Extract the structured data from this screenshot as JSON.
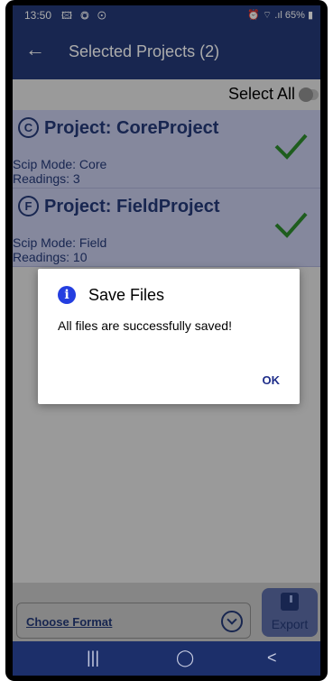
{
  "status_bar": {
    "time": "13:50",
    "icons_left": "🖾 ◎ ⊙",
    "right": "⏰ ⌔ .ıl 65% ▮"
  },
  "app_bar": {
    "title": "Selected Projects (2)"
  },
  "select_all": {
    "label": "Select All",
    "checked": false
  },
  "projects": [
    {
      "icon": "C",
      "title": "Project: CoreProject",
      "mode": "Scip Mode: Core",
      "readings": "Readings: 3",
      "selected": true
    },
    {
      "icon": "F",
      "title": "Project: FieldProject",
      "mode": "Scip Mode: Field",
      "readings": "Readings: 10",
      "selected": true
    }
  ],
  "format": {
    "label": "Choose Format"
  },
  "export": {
    "label": "Export"
  },
  "dialog": {
    "title": "Save Files",
    "message": "All files are successfully saved!",
    "ok_label": "OK"
  },
  "nav": {
    "recent": "|||",
    "home": "◯",
    "back": "<"
  },
  "colors": {
    "primary": "#243a78",
    "card": "#c7cbeb",
    "check": "#2e8b2e"
  }
}
